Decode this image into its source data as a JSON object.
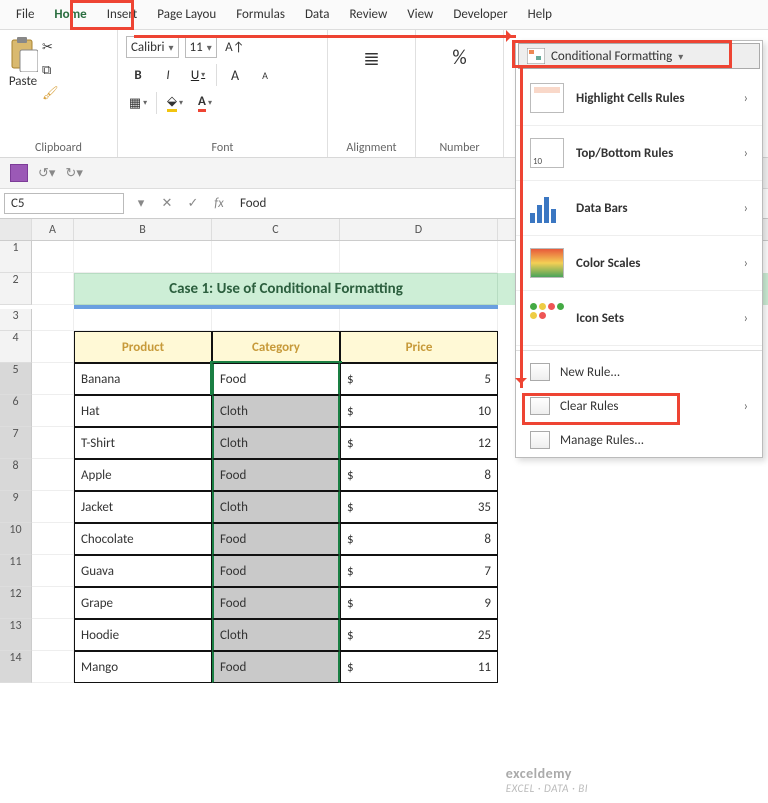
{
  "menu": {
    "file": "File",
    "home": "Home",
    "insert": "Insert",
    "pagelayout": "Page Layou",
    "formulas": "Formulas",
    "data": "Data",
    "review": "Review",
    "view": "View",
    "developer": "Developer",
    "help": "Help"
  },
  "ribbon": {
    "clipboard": {
      "paste": "Paste",
      "label": "Clipboard"
    },
    "font": {
      "name": "Calibri",
      "size": "11",
      "label": "Font",
      "bold": "B",
      "italic": "I",
      "underline": "U"
    },
    "alignment": {
      "label": "Alignment"
    },
    "number": {
      "label": "Number",
      "symbol": "%"
    }
  },
  "namebox": "C5",
  "formula": {
    "fx": "fx",
    "value": "Food"
  },
  "columns": [
    "A",
    "B",
    "C",
    "D"
  ],
  "title": "Case 1: Use of Conditional Formatting",
  "headers": {
    "product": "Product",
    "category": "Category",
    "price": "Price"
  },
  "currency": "$",
  "rows": [
    {
      "n": 5,
      "product": "Banana",
      "category": "Food",
      "price": 5
    },
    {
      "n": 6,
      "product": "Hat",
      "category": "Cloth",
      "price": 10
    },
    {
      "n": 7,
      "product": "T-Shirt",
      "category": "Cloth",
      "price": 12
    },
    {
      "n": 8,
      "product": "Apple",
      "category": "Food",
      "price": 8
    },
    {
      "n": 9,
      "product": "Jacket",
      "category": "Cloth",
      "price": 35
    },
    {
      "n": 10,
      "product": "Chocolate",
      "category": "Food",
      "price": 8
    },
    {
      "n": 11,
      "product": "Guava",
      "category": "Food",
      "price": 7
    },
    {
      "n": 12,
      "product": "Grape",
      "category": "Food",
      "price": 9
    },
    {
      "n": 13,
      "product": "Hoodie",
      "category": "Cloth",
      "price": 25
    },
    {
      "n": 14,
      "product": "Mango",
      "category": "Food",
      "price": 11
    }
  ],
  "cf": {
    "trigger": "Conditional Formatting",
    "items": {
      "hcr": "Highlight Cells Rules",
      "tb": "Top/Bottom Rules",
      "db": "Data Bars",
      "cs": "Color Scales",
      "is": "Icon Sets"
    },
    "sub": {
      "newrule": "New Rule...",
      "clear": "Clear Rules",
      "manage": "Manage Rules..."
    }
  },
  "watermark": {
    "brand": "exceldemy",
    "tag": "EXCEL · DATA · BI"
  }
}
